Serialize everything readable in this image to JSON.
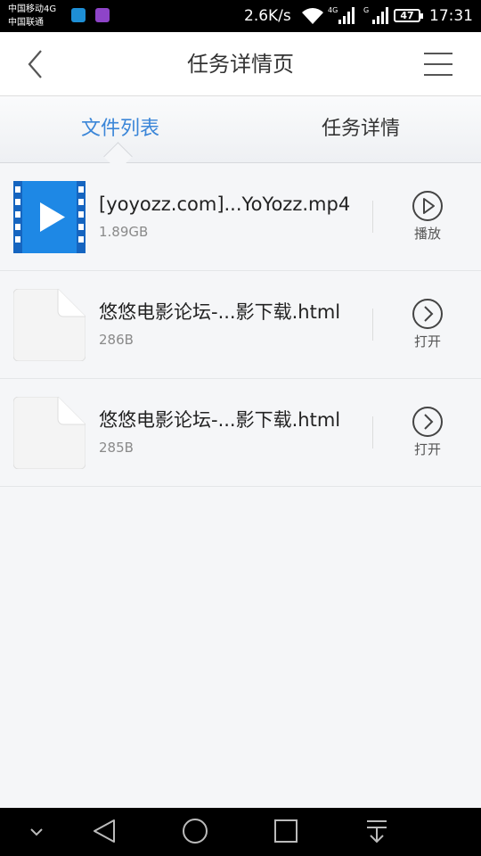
{
  "status_bar": {
    "carrier_1": "中国移动4G",
    "carrier_2": "中国联通",
    "speed": "2.6K/s",
    "battery": "47",
    "time": "17:31",
    "signal_1_label": "4G",
    "signal_2_label": "G"
  },
  "header": {
    "title": "任务详情页",
    "back_icon": "chevron-left-icon",
    "menu_icon": "hamburger-menu-icon"
  },
  "tabs": [
    {
      "label": "文件列表",
      "active": true
    },
    {
      "label": "任务详情",
      "active": false
    }
  ],
  "files": [
    {
      "name": "[yoyozz.com]...YoYozz.mp4",
      "size": "1.89GB",
      "icon": "video-file-icon",
      "action": "播放",
      "action_icon": "play-circle-icon"
    },
    {
      "name": "悠悠电影论坛-...影下载.html",
      "size": "286B",
      "icon": "blank-file-icon",
      "action": "打开",
      "action_icon": "open-circle-icon"
    },
    {
      "name": "悠悠电影论坛-...影下载.html",
      "size": "285B",
      "icon": "blank-file-icon",
      "action": "打开",
      "action_icon": "open-circle-icon"
    }
  ],
  "colors": {
    "accent": "#3b86d8",
    "video_icon": "#1e88e5"
  }
}
